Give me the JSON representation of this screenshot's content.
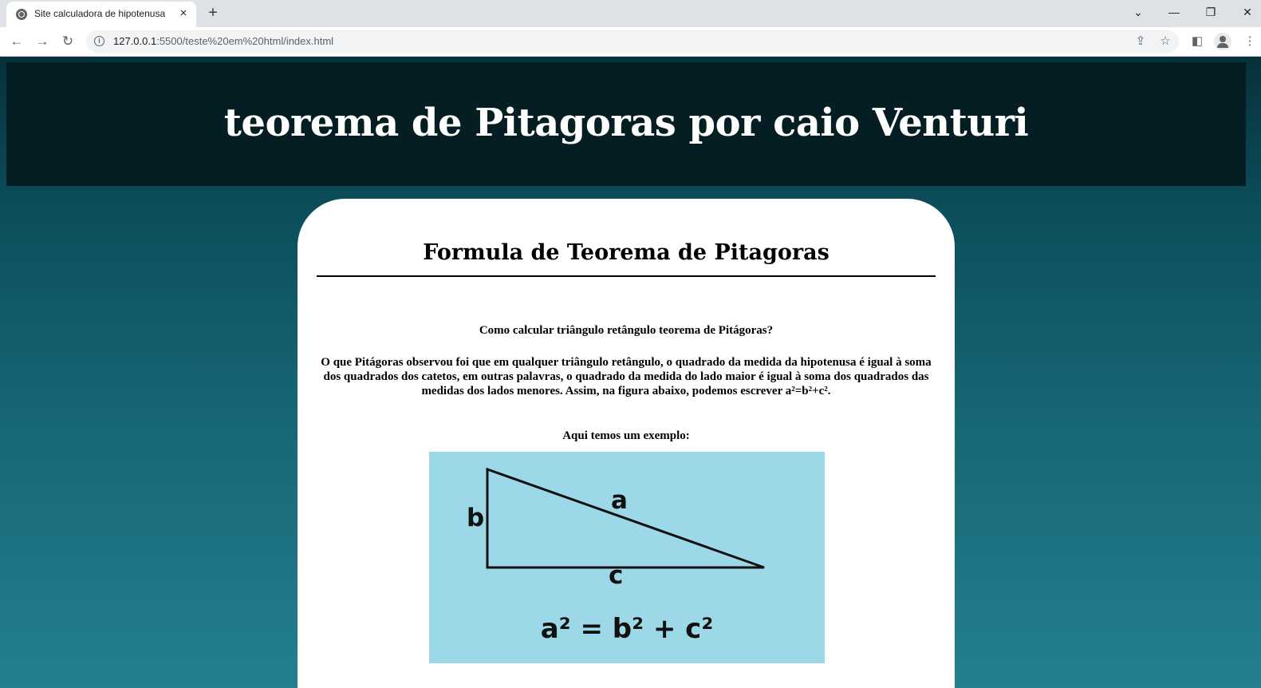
{
  "browser": {
    "tab_title": "Site calculadora de hipotenusa",
    "tab_close_icon": "×",
    "new_tab_icon": "+",
    "url_host": "127.0.0.1",
    "url_rest": ":5500/teste%20em%20html/index.html",
    "window_controls": {
      "tab_search": "⌄",
      "minimize": "—",
      "restore": "❐",
      "close": "✕"
    },
    "nav": {
      "back": "←",
      "forward": "→",
      "reload": "↻"
    },
    "info_icon": "i",
    "share_icon": "⇪",
    "bookmark_icon": "☆",
    "side_panel_icon": "◧",
    "menu_icon": "⋮"
  },
  "page": {
    "header_title": "teorema de Pitagoras por caio Venturi",
    "card": {
      "heading": "Formula de Teorema de Pitagoras",
      "question": "Como calcular triângulo retângulo teorema de Pitágoras?",
      "explanation": "O que Pitágoras observou foi que em qualquer triângulo retângulo, o quadrado da medida da hipotenusa é igual à soma dos quadrados dos catetos, em outras palavras, o quadrado da medida do lado maior é igual à soma dos quadrados das medidas dos lados menores. Assim, na figura abaixo, podemos escrever a²=b²+c².",
      "example_label": "Aqui temos um exemplo:"
    },
    "figure": {
      "label_a": "a",
      "label_b": "b",
      "label_c": "c",
      "formula": "a² = b² + c²"
    }
  }
}
